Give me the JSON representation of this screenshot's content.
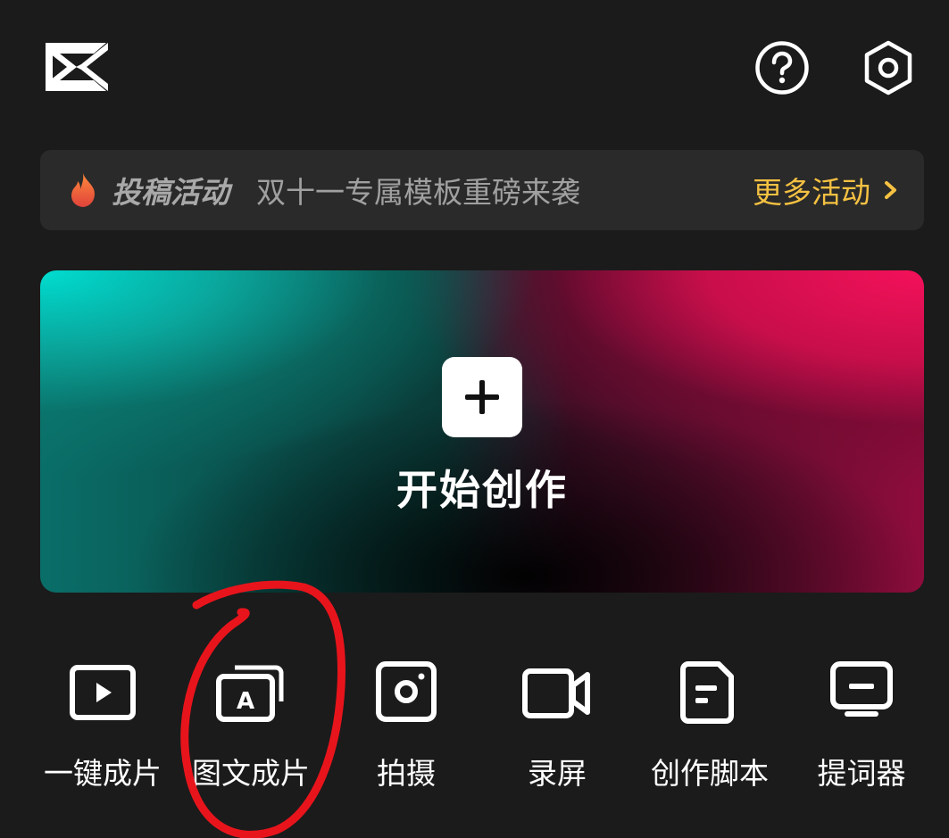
{
  "header": {
    "logo_icon": "capcut-logo-icon",
    "help_icon": "help-circle-icon",
    "settings_icon": "settings-hexagon-icon"
  },
  "banner": {
    "tag": "投稿活动",
    "text": "双十一专属模板重磅来袭",
    "more": "更多活动",
    "more_color": "#f5c142",
    "tag_icon": "flame-icon"
  },
  "create": {
    "label": "开始创作",
    "icon": "plus-icon"
  },
  "tools": [
    {
      "label": "一键成片",
      "icon": "play-video-icon"
    },
    {
      "label": "图文成片",
      "icon": "text-to-video-icon"
    },
    {
      "label": "拍摄",
      "icon": "camera-icon"
    },
    {
      "label": "录屏",
      "icon": "screen-record-icon"
    },
    {
      "label": "创作脚本",
      "icon": "script-document-icon"
    },
    {
      "label": "提词器",
      "icon": "teleprompter-icon"
    }
  ],
  "annotation": {
    "color": "#e8141c"
  }
}
